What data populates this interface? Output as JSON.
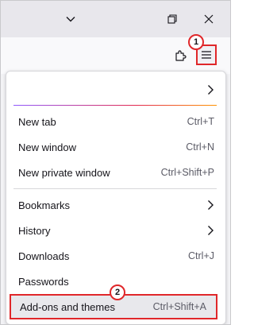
{
  "window_controls": {
    "icons": [
      "chevron-down-icon",
      "restore-icon",
      "close-icon"
    ]
  },
  "toolbar": {
    "icons": [
      "extensions-icon",
      "hamburger-menu-icon"
    ]
  },
  "callouts": {
    "first": "1",
    "second": "2"
  },
  "accent_color": "#e0272a",
  "menu": {
    "items": [
      {
        "label": "New tab",
        "shortcut": "Ctrl+T"
      },
      {
        "label": "New window",
        "shortcut": "Ctrl+N"
      },
      {
        "label": "New private window",
        "shortcut": "Ctrl+Shift+P"
      },
      {
        "label": "Bookmarks",
        "shortcut": ""
      },
      {
        "label": "History",
        "shortcut": ""
      },
      {
        "label": "Downloads",
        "shortcut": "Ctrl+J"
      },
      {
        "label": "Passwords",
        "shortcut": ""
      },
      {
        "label": "Add-ons and themes",
        "shortcut": "Ctrl+Shift+A"
      }
    ]
  }
}
